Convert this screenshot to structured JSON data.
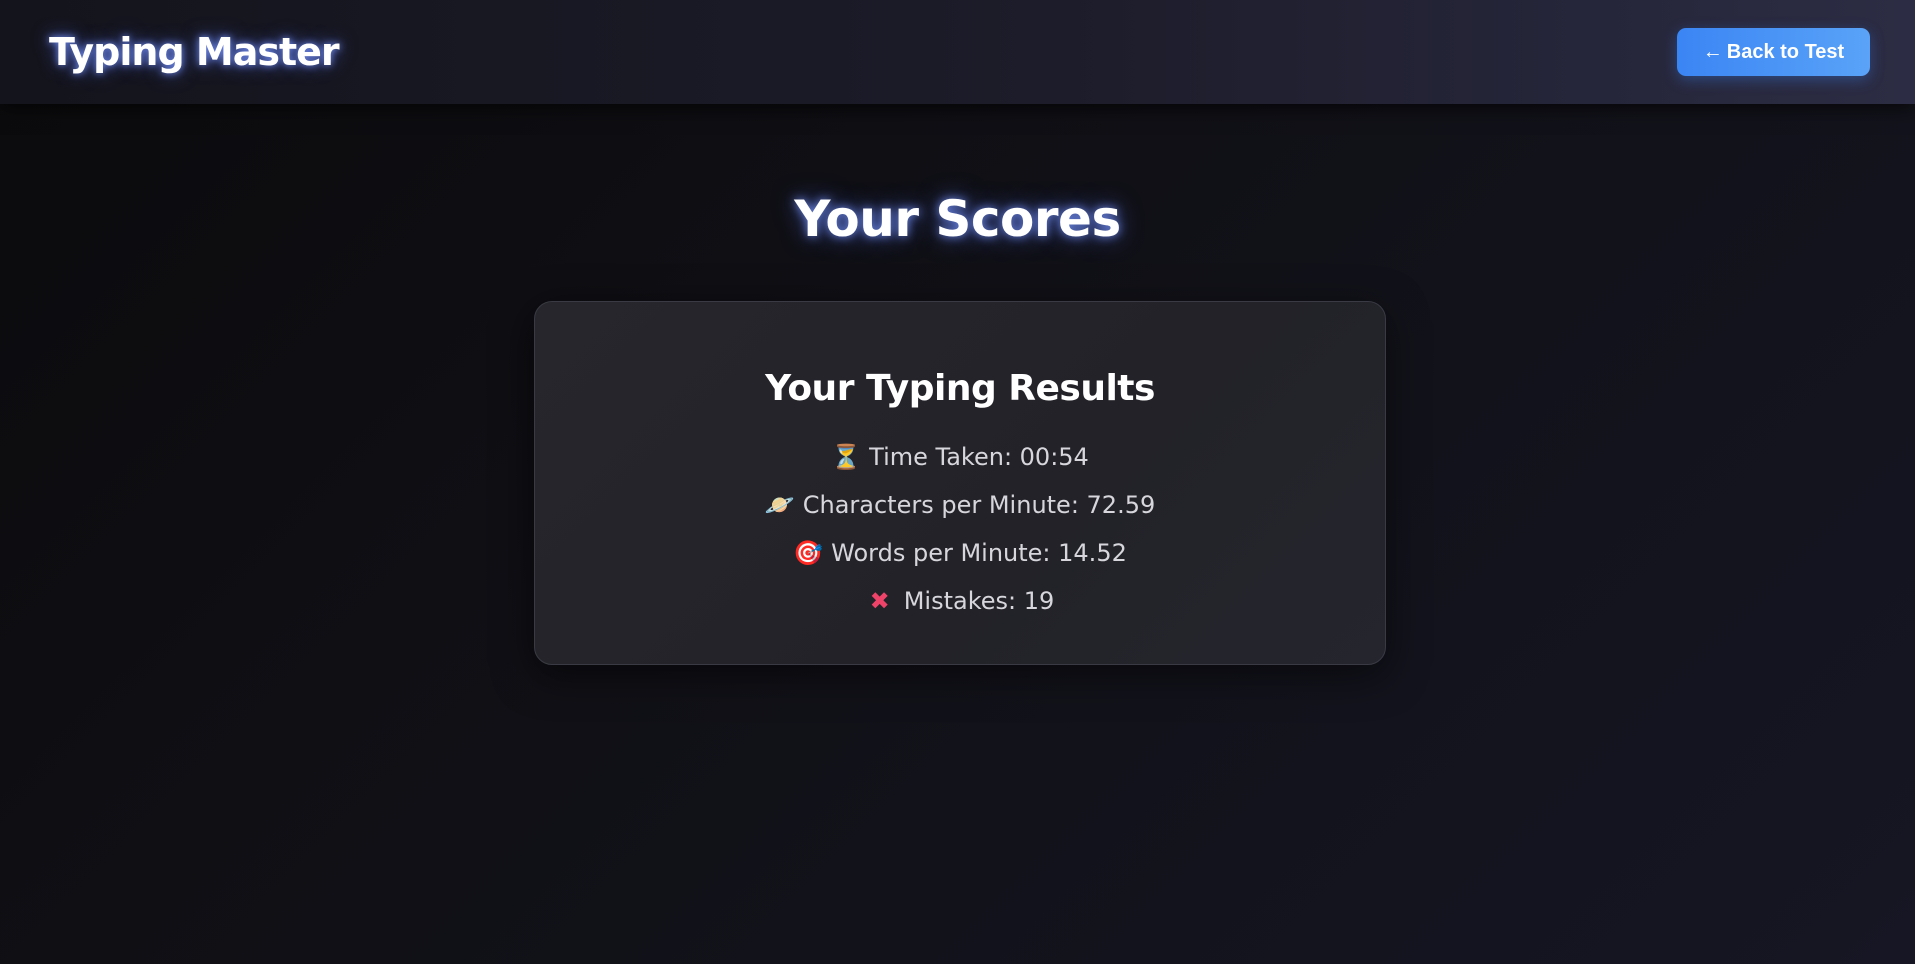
{
  "navbar": {
    "brand": "Typing Master",
    "back_button": {
      "arrow": "←",
      "label": "Back to Test"
    }
  },
  "main": {
    "page_title": "Your Scores",
    "results_card": {
      "title": "Your Typing Results",
      "stats": [
        {
          "icon": "hourglass-icon",
          "glyph": "⏳",
          "label": "Time Taken: 00:54"
        },
        {
          "icon": "planet-icon",
          "glyph": "🪐",
          "label": "Characters per Minute: 72.59"
        },
        {
          "icon": "target-icon",
          "glyph": "🎯",
          "label": "Words per Minute: 14.52"
        },
        {
          "icon": "cross-mark-icon",
          "glyph": "✖",
          "label": "Mistakes: 19"
        }
      ]
    }
  },
  "colors": {
    "accent": "#3a85f4",
    "mistake": "#f0436a",
    "background": "#101016"
  }
}
